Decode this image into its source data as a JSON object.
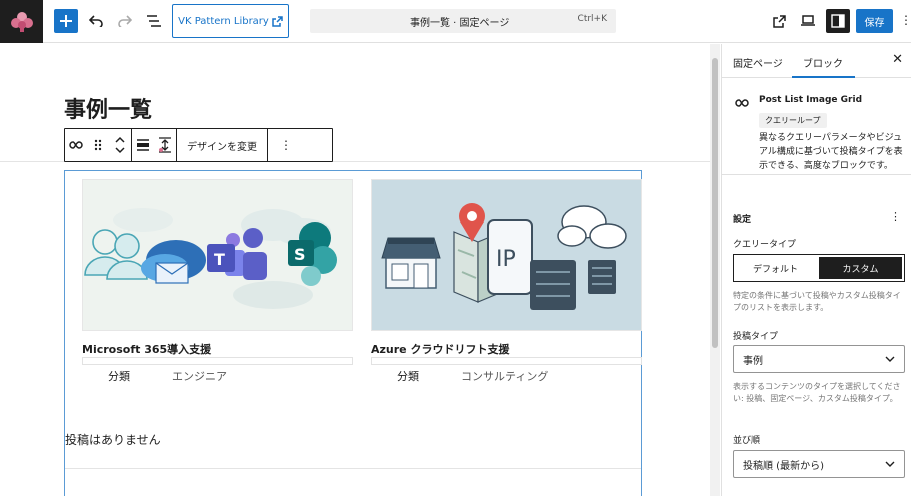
{
  "topbar": {
    "vk_button": "VK Pattern Library",
    "command_title": "事例一覧 · 固定ページ",
    "command_shortcut": "Ctrl+K",
    "save_label": "保存",
    "more": "⋮"
  },
  "canvas": {
    "page_title": "事例一覧",
    "toolbar_design_label": "デザインを変更",
    "toolbar_more": "⋮",
    "cards": [
      {
        "title": "Microsoft 365導入支援",
        "meta_key": "分類",
        "meta_value": "エンジニア"
      },
      {
        "title": "Azure クラウドリフト支援",
        "meta_key": "分類",
        "meta_value": "コンサルティング"
      }
    ],
    "no_posts": "投稿はありません",
    "ip_label": "IP"
  },
  "sidebar": {
    "tab_page": "固定ページ",
    "tab_block": "ブロック",
    "close": "✕",
    "block_name": "Post List Image Grid",
    "block_badge": "クエリーループ",
    "block_desc": "異なるクエリーパラメータやビジュアル構成に基づいて投稿タイプを表示できる、高度なブロックです。",
    "settings_heading": "設定",
    "settings_more": "⋮",
    "query_type_label": "クエリータイプ",
    "query_default": "デフォルト",
    "query_custom": "カスタム",
    "query_help": "特定の条件に基づいて投稿やカスタム投稿タイプのリストを表示します。",
    "post_type_label": "投稿タイプ",
    "post_type_value": "事例",
    "post_type_help": "表示するコンテンツのタイプを選択してください: 投稿、固定ページ、カスタム投稿タイプ。",
    "order_label": "並び順",
    "order_value": "投稿順 (最新から)"
  },
  "colors": {
    "accent": "#1874c8",
    "dark": "#1e1e1e",
    "block_border": "#5b9bd5"
  }
}
